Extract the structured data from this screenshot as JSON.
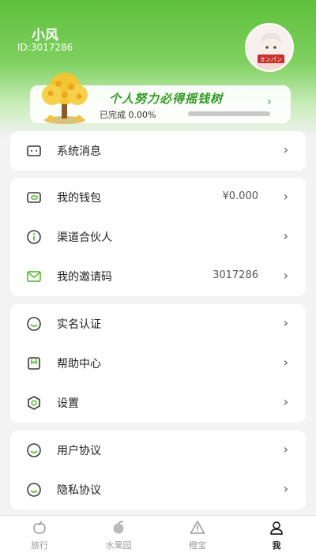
{
  "profile": {
    "name": "小风",
    "id_text": "ID:3017286",
    "avatar_text": "きンパン"
  },
  "banner": {
    "title": "个人努力必得摇钱树",
    "progress_label": "已完成 0.00%",
    "progress_fraction": 0.0
  },
  "menu": {
    "messages": {
      "label": "系统消息"
    },
    "wallet": {
      "label": "我的钱包",
      "value": "¥0.000"
    },
    "partner": {
      "label": "渠道合伙人"
    },
    "invite": {
      "label": "我的邀请码",
      "value": "3017286"
    },
    "realname": {
      "label": "实名认证"
    },
    "help": {
      "label": "帮助中心"
    },
    "settings": {
      "label": "设置"
    },
    "user_agreement": {
      "label": "用户协议"
    },
    "privacy": {
      "label": "隐私协议"
    },
    "chevron": "›"
  },
  "tabbar": {
    "tabs": [
      {
        "label": "旅行",
        "icon": "apple-icon"
      },
      {
        "label": "水果园",
        "icon": "fruit-icon"
      },
      {
        "label": "橙宝",
        "icon": "warning-icon"
      },
      {
        "label": "我",
        "icon": "user-icon"
      }
    ]
  },
  "colors": {
    "accent": "#5ec03c",
    "accent_dark": "#2f9a23"
  }
}
